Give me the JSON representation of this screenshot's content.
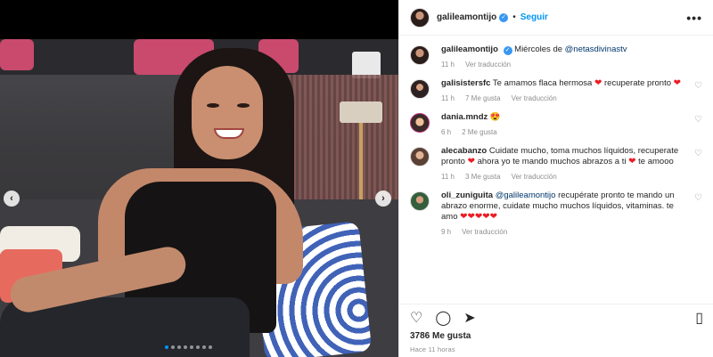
{
  "post": {
    "username": "galileamontijo",
    "follow_label": "Seguir",
    "more_label": "•••",
    "caption": {
      "username": "galileamontijo",
      "text": "Miércoles de ",
      "mention": "@netasdivinastv",
      "time": "11 h",
      "translate": "Ver traducción"
    },
    "likes": "3786 Me gusta",
    "time_ago": "Hace 11 horas"
  },
  "media": {
    "prev_label": "‹",
    "next_label": "›",
    "dots_count": 8,
    "active_dot": 0
  },
  "comments": [
    {
      "username": "galisistersfc",
      "text": "Te amamos flaca hermosa ",
      "emoji_a": "❤",
      "text_b": " recuperate pronto ",
      "emoji_b": "❤",
      "time": "11 h",
      "likes": "7 Me gusta",
      "translate": "Ver traducción"
    },
    {
      "username": "dania.mndz",
      "text": "",
      "emoji": "😍",
      "time": "6 h",
      "likes": "2 Me gusta"
    },
    {
      "username": "alecabanzo",
      "text": "Cuidate mucho, toma muchos líquidos, recuperate pronto ",
      "emoji_a": "❤",
      "text_b": " ahora yo te mando muchos abrazos a ti ",
      "emoji_b": "❤",
      "text_c": " te amooo",
      "time": "11 h",
      "likes": "3 Me gusta",
      "translate": "Ver traducción"
    },
    {
      "username": "oli_zuniguita",
      "mention": "@galileamontijo",
      "text": " recupérate pronto te mando un abrazo enorme, cuidate mucho muchos líquidos, vitaminas. te amo ",
      "emoji": "❤❤❤❤❤",
      "time": "9 h",
      "translate": "Ver traducción"
    }
  ],
  "icons": {
    "like": "♡",
    "comment": "◯",
    "share": "➤",
    "save": "▯",
    "verified": "✓"
  },
  "colors": {
    "accent": "#0095f6",
    "verified": "#3897f0",
    "heart": "#ed1c24",
    "muted": "#8e8e8e"
  }
}
